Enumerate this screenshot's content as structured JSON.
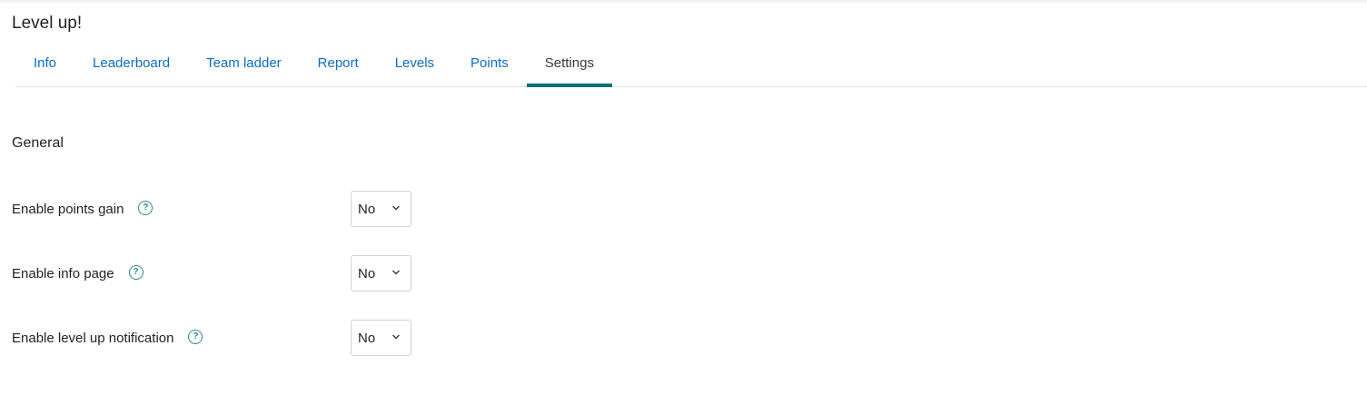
{
  "page": {
    "title": "Level up!"
  },
  "tabs": [
    {
      "label": "Info",
      "active": false
    },
    {
      "label": "Leaderboard",
      "active": false
    },
    {
      "label": "Team ladder",
      "active": false
    },
    {
      "label": "Report",
      "active": false
    },
    {
      "label": "Levels",
      "active": false
    },
    {
      "label": "Points",
      "active": false
    },
    {
      "label": "Settings",
      "active": true
    }
  ],
  "section": {
    "title": "General"
  },
  "settings": [
    {
      "label": "Enable points gain",
      "value": "No",
      "help_icon": "question-circle-icon"
    },
    {
      "label": "Enable info page",
      "value": "No",
      "help_icon": "question-circle-icon"
    },
    {
      "label": "Enable level up notification",
      "value": "No",
      "help_icon": "question-circle-icon"
    }
  ],
  "colors": {
    "link": "#0f6cbf",
    "active_tab_indicator": "#0f6e6e",
    "help_icon": "#2e8a8a"
  }
}
